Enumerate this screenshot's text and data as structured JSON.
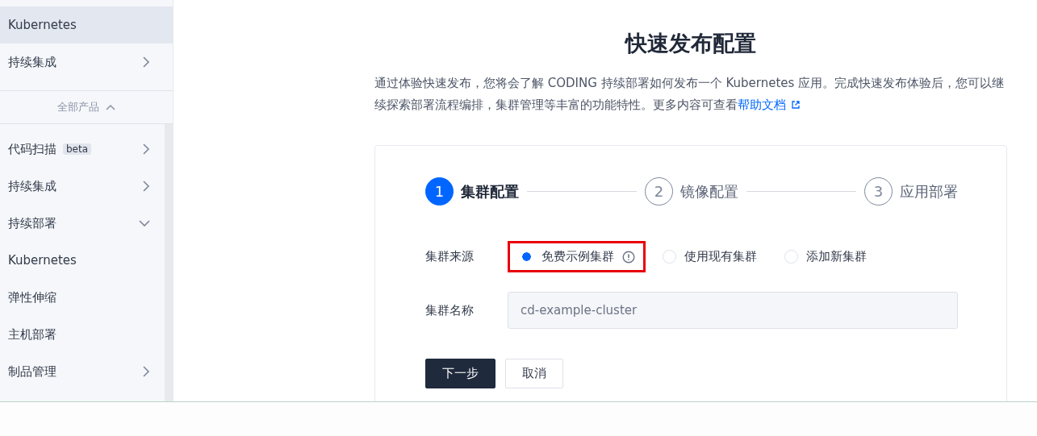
{
  "sidebar": {
    "top_items": [
      {
        "label": "Kubernetes",
        "selected": true,
        "kind": "leaf"
      },
      {
        "label": "持续集成",
        "selected": false,
        "kind": "group",
        "expanded": false
      }
    ],
    "section_toggle": {
      "label": "全部产品",
      "expanded": true
    },
    "items": [
      {
        "label": "代码扫描",
        "badge": "beta",
        "kind": "group",
        "expanded": false,
        "selected": false
      },
      {
        "label": "持续集成",
        "kind": "group",
        "expanded": false,
        "selected": false
      },
      {
        "label": "持续部署",
        "kind": "group",
        "expanded": true,
        "selected": false
      },
      {
        "label": "Kubernetes",
        "kind": "leaf",
        "selected": false
      },
      {
        "label": "弹性伸缩",
        "kind": "leaf",
        "selected": false
      },
      {
        "label": "主机部署",
        "kind": "leaf",
        "selected": false
      },
      {
        "label": "制品管理",
        "kind": "group",
        "expanded": false,
        "selected": false
      }
    ]
  },
  "main": {
    "title": "快速发布配置",
    "intro": "通过体验快速发布，您将会了解 CODING 持续部署如何发布一个 Kubernetes 应用。完成快速发布体验后，您可以继续探索部署流程编排，集群管理等丰富的功能特性。更多内容可查看",
    "help_link": "帮助文档",
    "steps": [
      {
        "number": "1",
        "label": "集群配置",
        "selected": true
      },
      {
        "number": "2",
        "label": "镜像配置",
        "selected": false
      },
      {
        "number": "3",
        "label": "应用部署",
        "selected": false
      }
    ],
    "source": {
      "label": "集群来源",
      "options": [
        {
          "label": "免费示例集群",
          "selected": true,
          "info": true,
          "highlighted": true
        },
        {
          "label": "使用现有集群",
          "selected": false,
          "info": false,
          "highlighted": false
        },
        {
          "label": "添加新集群",
          "selected": false,
          "info": false,
          "highlighted": false
        }
      ]
    },
    "name_field": {
      "label": "集群名称",
      "value": "cd-example-cluster",
      "disabled": true
    },
    "buttons": [
      {
        "label": "下一步",
        "kind": "primary"
      },
      {
        "label": "取消",
        "kind": "secondary"
      }
    ]
  }
}
